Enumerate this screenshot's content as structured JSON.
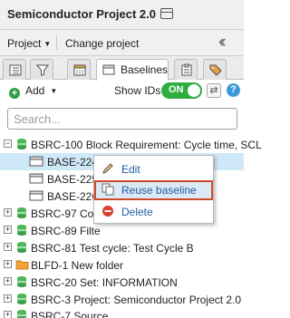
{
  "window": {
    "title": "Semiconductor Project 2.0"
  },
  "menubar": {
    "project_menu": "Project",
    "change_project": "Change project"
  },
  "tabs": {
    "baselines_label": "Baselines"
  },
  "toolbar": {
    "add_label": "Add",
    "show_ids_label": "Show IDs",
    "toggle_state": "ON"
  },
  "search": {
    "placeholder": "Search..."
  },
  "tree": {
    "items": [
      {
        "label": "BSRC-100 Block Requirement: Cycle time, SCL",
        "type": "stack",
        "expander": "minus"
      },
      {
        "label": "BASE-224 R1 - 04/10/2020",
        "type": "baseline"
      },
      {
        "label": "BASE-225",
        "type": "baseline"
      },
      {
        "label": "BASE-226",
        "type": "baseline"
      },
      {
        "label": "BSRC-97 Con",
        "type": "stack",
        "expander": "plus"
      },
      {
        "label": "BSRC-89 Filte",
        "type": "stack",
        "expander": "plus"
      },
      {
        "label": "BSRC-81 Test cycle: Test Cycle B",
        "type": "stack",
        "expander": "plus"
      },
      {
        "label": "BLFD-1 New folder",
        "type": "folder",
        "expander": "plus"
      },
      {
        "label": "BSRC-20 Set: INFORMATION",
        "type": "stack",
        "expander": "plus"
      },
      {
        "label": "BSRC-3 Project: Semiconductor Project 2.0",
        "type": "stack",
        "expander": "plus"
      },
      {
        "label": "BSRC-7 Source",
        "type": "stack",
        "expander": "plus"
      }
    ]
  },
  "context_menu": {
    "items": [
      {
        "label": "Edit",
        "icon": "pencil-icon"
      },
      {
        "label": "Reuse baseline",
        "icon": "copy-icon"
      },
      {
        "label": "Delete",
        "icon": "delete-icon"
      }
    ]
  },
  "colors": {
    "accent_green": "#2eae3f",
    "selection_blue": "#cfe8f7",
    "highlight_border": "#d14a28",
    "link_blue": "#1d5c9e"
  }
}
